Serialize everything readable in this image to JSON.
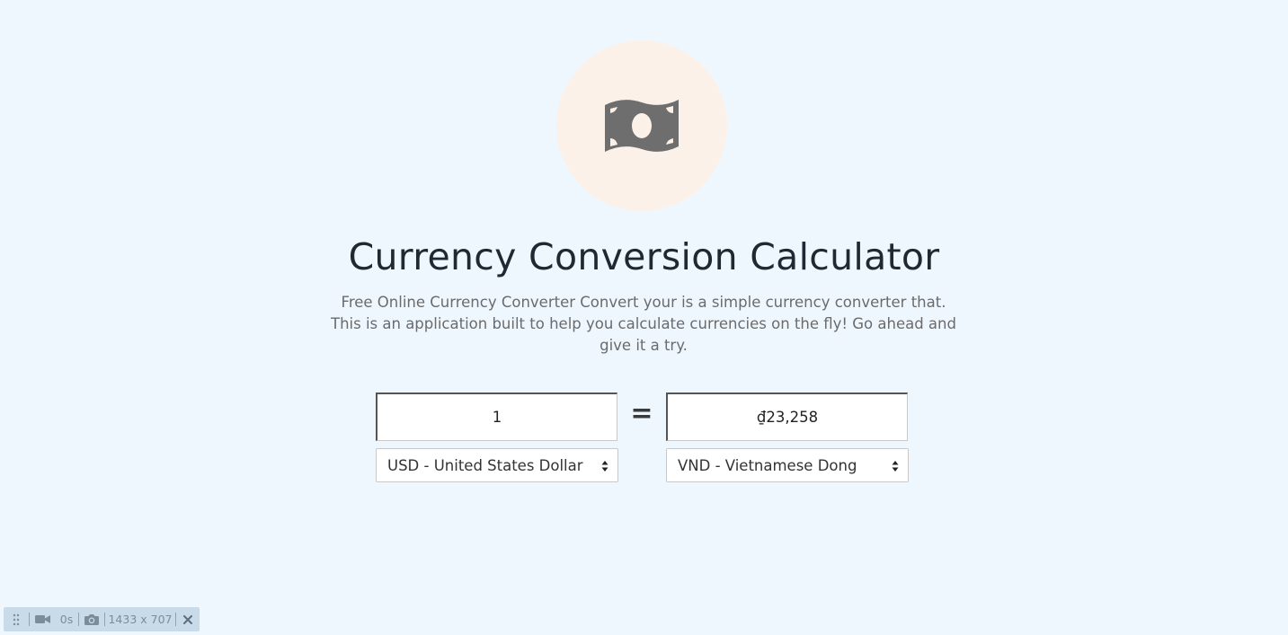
{
  "hero": {
    "icon": "money-bill-icon",
    "circle_color": "#fbf1e8",
    "icon_color": "#6e6e6e"
  },
  "header": {
    "title": "Currency Conversion Calculator",
    "description": "Free Online Currency Converter Convert your is a simple currency converter that. This is an application built to help you calculate currencies on the fly! Go ahead and give it a try."
  },
  "converter": {
    "from_amount": "1",
    "equals_sign": "=",
    "to_amount": "₫23,258",
    "from_currency": "USD - United States Dollar",
    "to_currency": "VND - Vietnamese Dong"
  },
  "toolbar": {
    "timer": "0s",
    "dimensions": "1433 x 707",
    "icons": [
      "drag-handle-icon",
      "video-camera-icon",
      "camera-icon",
      "close-icon"
    ]
  },
  "colors": {
    "background": "#eff7fe",
    "title": "#1f2933",
    "description": "#6b6b6b",
    "toolbar_bg": "#c9dbe8"
  }
}
